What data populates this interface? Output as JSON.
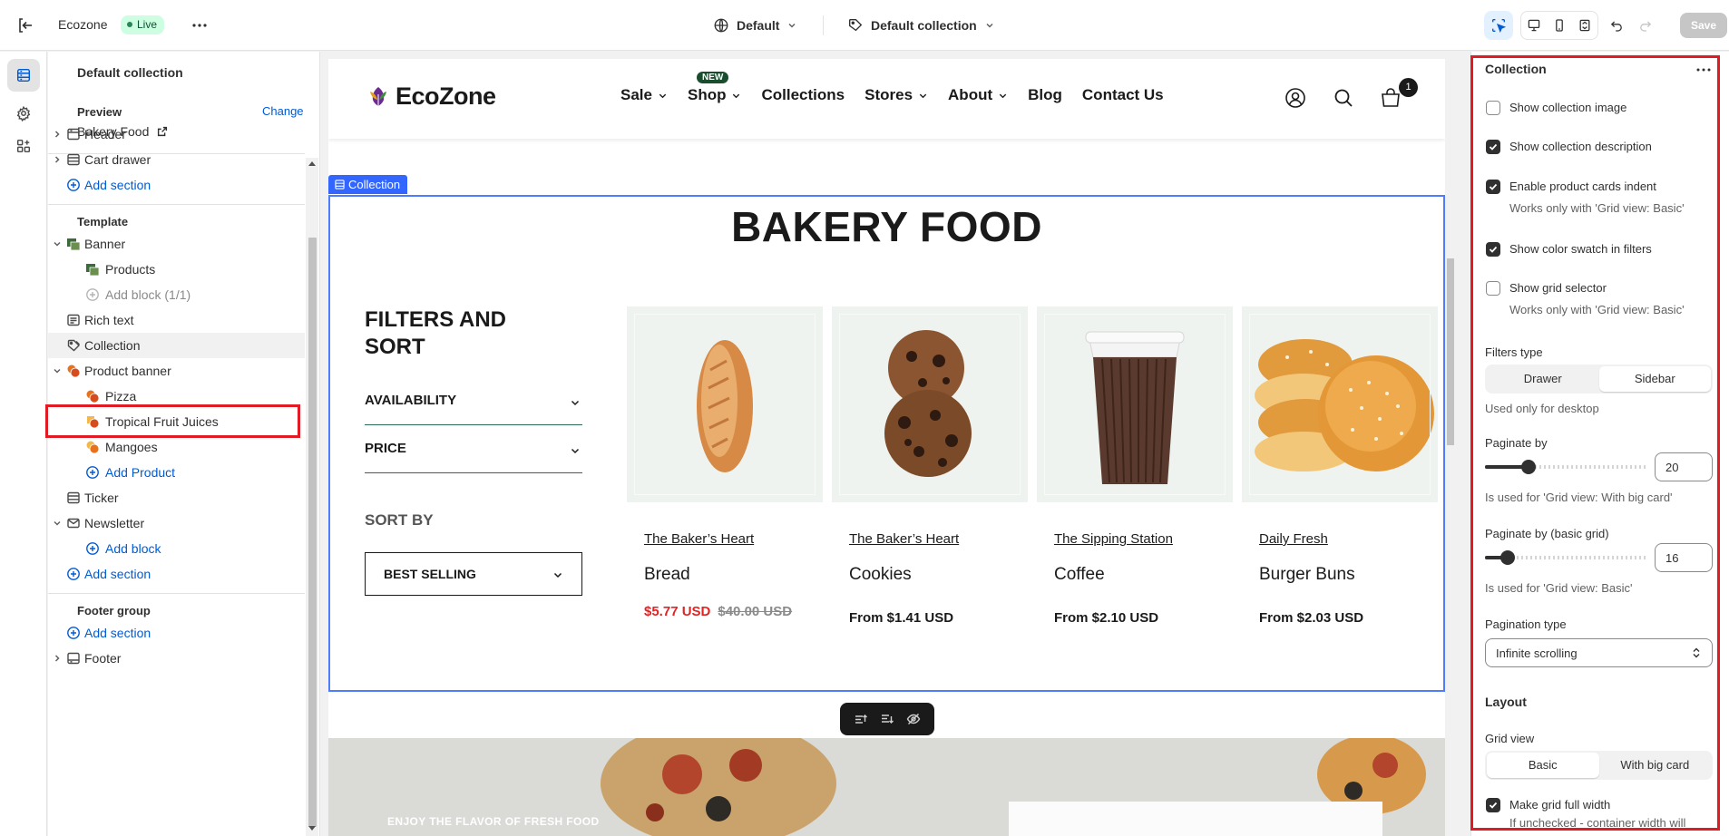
{
  "topbar": {
    "store_name": "Ecozone",
    "status": "Live",
    "theme_selector": "Default",
    "template_selector": "Default collection",
    "save_label": "Save"
  },
  "sidebar": {
    "title": "Default collection",
    "preview_label": "Preview",
    "preview_change": "Change",
    "preview_value": "Bakery Food",
    "header_items": [
      {
        "label": "Header"
      },
      {
        "label": "Cart drawer"
      },
      {
        "label": "Add section"
      }
    ],
    "template_label": "Template",
    "template_items": [
      {
        "label": "Banner"
      },
      {
        "label": "Products"
      },
      {
        "label": "Add block (1/1)"
      },
      {
        "label": "Rich text"
      },
      {
        "label": "Collection"
      },
      {
        "label": "Product banner"
      },
      {
        "label": "Pizza"
      },
      {
        "label": "Tropical Fruit Juices"
      },
      {
        "label": "Mangoes"
      },
      {
        "label": "Add Product"
      },
      {
        "label": "Ticker"
      },
      {
        "label": "Newsletter"
      },
      {
        "label": "Add block"
      },
      {
        "label": "Add section"
      }
    ],
    "footer_group_label": "Footer group",
    "footer_items": [
      {
        "label": "Add section"
      },
      {
        "label": "Footer"
      }
    ]
  },
  "store": {
    "logo_text": "EcoZone",
    "nav": [
      {
        "label": "Sale"
      },
      {
        "label": "Shop",
        "badge": "NEW"
      },
      {
        "label": "Collections"
      },
      {
        "label": "Stores"
      },
      {
        "label": "About"
      },
      {
        "label": "Blog"
      },
      {
        "label": "Contact Us"
      }
    ],
    "cart_count": "1",
    "section_tag": "Collection",
    "collection_title": "BAKERY FOOD",
    "filters_title": "FILTERS AND SORT",
    "filters": [
      "AVAILABILITY",
      "PRICE"
    ],
    "sort_label": "SORT BY",
    "sort_value": "BEST SELLING",
    "products": [
      {
        "brand": "The Baker’s Heart",
        "name": "Bread",
        "price": "$5.77 USD",
        "compare_price": "$40.00 USD"
      },
      {
        "brand": "The Baker’s Heart",
        "name": "Cookies",
        "price": "From $1.41 USD"
      },
      {
        "brand": "The Sipping Station",
        "name": "Coffee",
        "price": "From $2.10 USD"
      },
      {
        "brand": "Daily Fresh",
        "name": "Burger Buns",
        "price": "From $2.03 USD"
      }
    ],
    "banner_text": "ENJOY THE FLAVOR OF FRESH FOOD"
  },
  "settings": {
    "title": "Collection",
    "checkboxes": [
      {
        "label": "Show collection image",
        "checked": false
      },
      {
        "label": "Show collection description",
        "checked": true
      },
      {
        "label": "Enable product cards indent",
        "checked": true,
        "help": "Works only with 'Grid view: Basic'"
      },
      {
        "label": "Show color swatch in filters",
        "checked": true
      },
      {
        "label": "Show grid selector",
        "checked": false,
        "help": "Works only with 'Grid view: Basic'"
      }
    ],
    "filters_type": {
      "label": "Filters type",
      "options": [
        "Drawer",
        "Sidebar"
      ],
      "selected": "Sidebar",
      "help": "Used only for desktop"
    },
    "paginate_by": {
      "label": "Paginate by",
      "value": "20",
      "help": "Is used for 'Grid view: With big card'"
    },
    "paginate_by_basic": {
      "label": "Paginate by (basic grid)",
      "value": "16",
      "help": "Is used for 'Grid view: Basic'"
    },
    "pagination_type": {
      "label": "Pagination type",
      "value": "Infinite scrolling"
    },
    "layout_label": "Layout",
    "grid_view": {
      "label": "Grid view",
      "options": [
        "Basic",
        "With big card"
      ],
      "selected": "Basic"
    },
    "full_width": {
      "label": "Make grid full width",
      "checked": true,
      "help": "If unchecked - container width will"
    }
  },
  "colors": {
    "accent": "#005bd3",
    "selection_frame": "#4f7cff",
    "highlight": "#e01b24",
    "sale_price": "#e02424",
    "live_badge": "#cdfee1"
  }
}
